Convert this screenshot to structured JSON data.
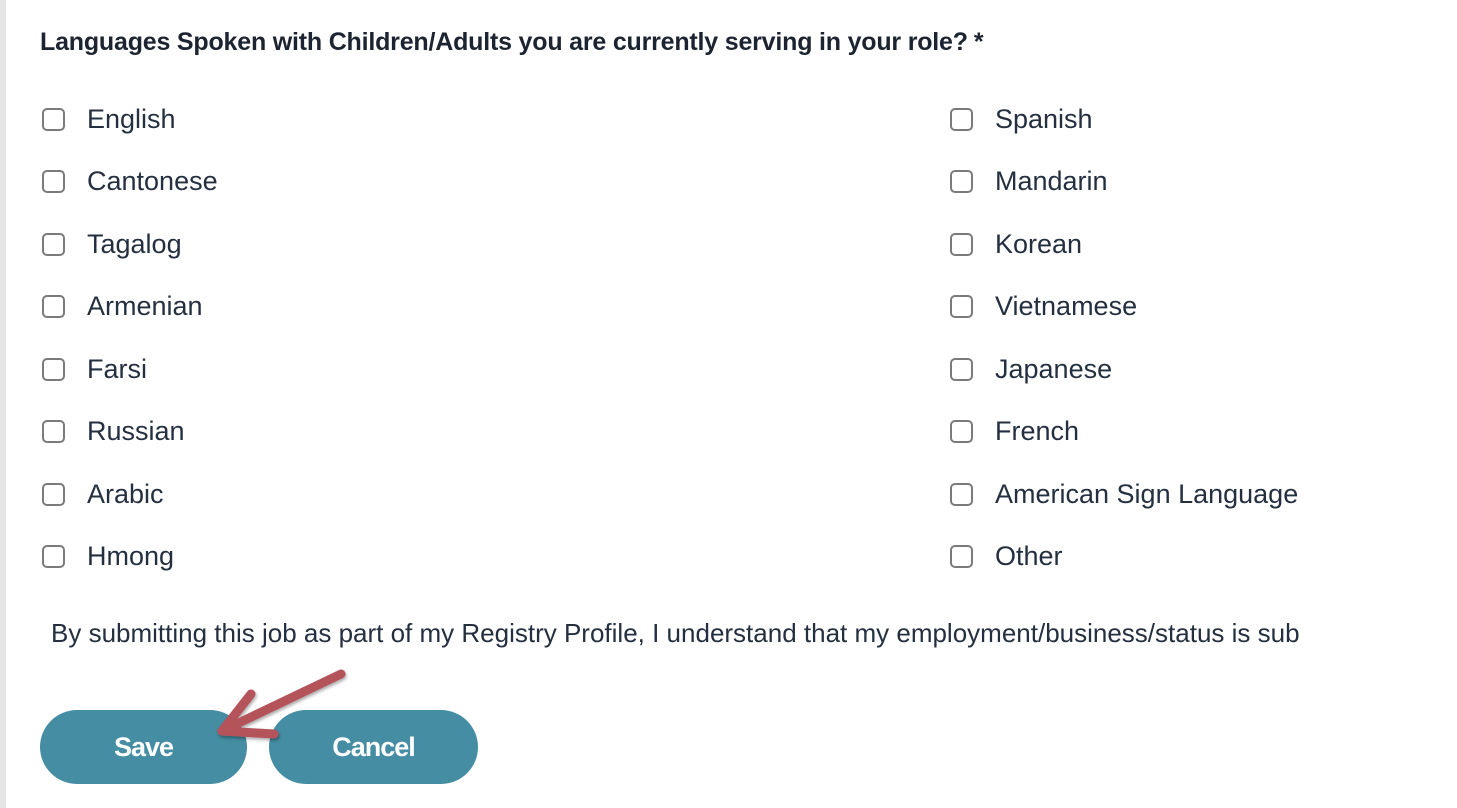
{
  "question": {
    "label": "Languages Spoken with Children/Adults you are currently serving in your role?",
    "required_marker": "*"
  },
  "options": {
    "left": [
      {
        "label": "English",
        "checked": false
      },
      {
        "label": "Cantonese",
        "checked": false
      },
      {
        "label": "Tagalog",
        "checked": false
      },
      {
        "label": "Armenian",
        "checked": false
      },
      {
        "label": "Farsi",
        "checked": false
      },
      {
        "label": "Russian",
        "checked": false
      },
      {
        "label": "Arabic",
        "checked": false
      },
      {
        "label": "Hmong",
        "checked": false
      }
    ],
    "right": [
      {
        "label": "Spanish",
        "checked": false
      },
      {
        "label": "Mandarin",
        "checked": false
      },
      {
        "label": "Korean",
        "checked": false
      },
      {
        "label": "Vietnamese",
        "checked": false
      },
      {
        "label": "Japanese",
        "checked": false
      },
      {
        "label": "French",
        "checked": false
      },
      {
        "label": "American Sign Language",
        "checked": false
      },
      {
        "label": "Other",
        "checked": false
      }
    ]
  },
  "disclaimer": "By submitting this job as part of my Registry Profile, I understand that my employment/business/status is sub",
  "buttons": {
    "save": "Save",
    "cancel": "Cancel"
  },
  "colors": {
    "button_bg": "#448da3",
    "annotation_arrow": "#b5525a"
  }
}
